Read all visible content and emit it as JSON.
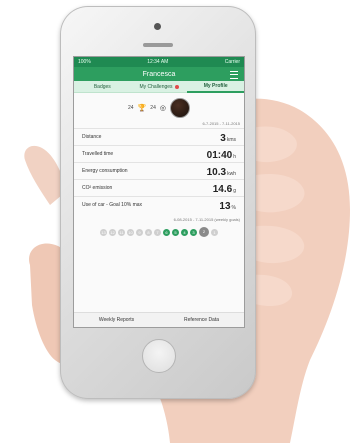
{
  "status": {
    "left": "100%",
    "time": "12:34 AM",
    "carrier": "Carrier"
  },
  "app": {
    "title": "Francesca"
  },
  "tabs": [
    {
      "label": "My Profile"
    },
    {
      "label": "My Challenges"
    },
    {
      "label": "Badges"
    }
  ],
  "profile": {
    "rank": "24",
    "points": "24"
  },
  "period": {
    "label": "6-7-2015 - 7-11-2015"
  },
  "stats": [
    {
      "value": "3",
      "unit": "kms",
      "label": "Distance"
    },
    {
      "value": "01:40",
      "unit": "h",
      "label": "Travelled time"
    },
    {
      "value": "10.3",
      "unit": "kwh",
      "label": "Energy consumption"
    },
    {
      "value": "14.6",
      "unit": "g",
      "label": "CO² emission"
    },
    {
      "value": "13",
      "unit": "%",
      "label": "Use of car - Goal 10% max"
    }
  ],
  "week": {
    "label": "6-08-2015 - 7-11-2015 (weekly goals)"
  },
  "days": [
    "1",
    "2",
    "3",
    "4",
    "5",
    "6",
    "7",
    "8",
    "9",
    "10",
    "11",
    "12",
    "13"
  ],
  "bottom": {
    "left": "Weekly Reports",
    "right": "Reference Data"
  }
}
